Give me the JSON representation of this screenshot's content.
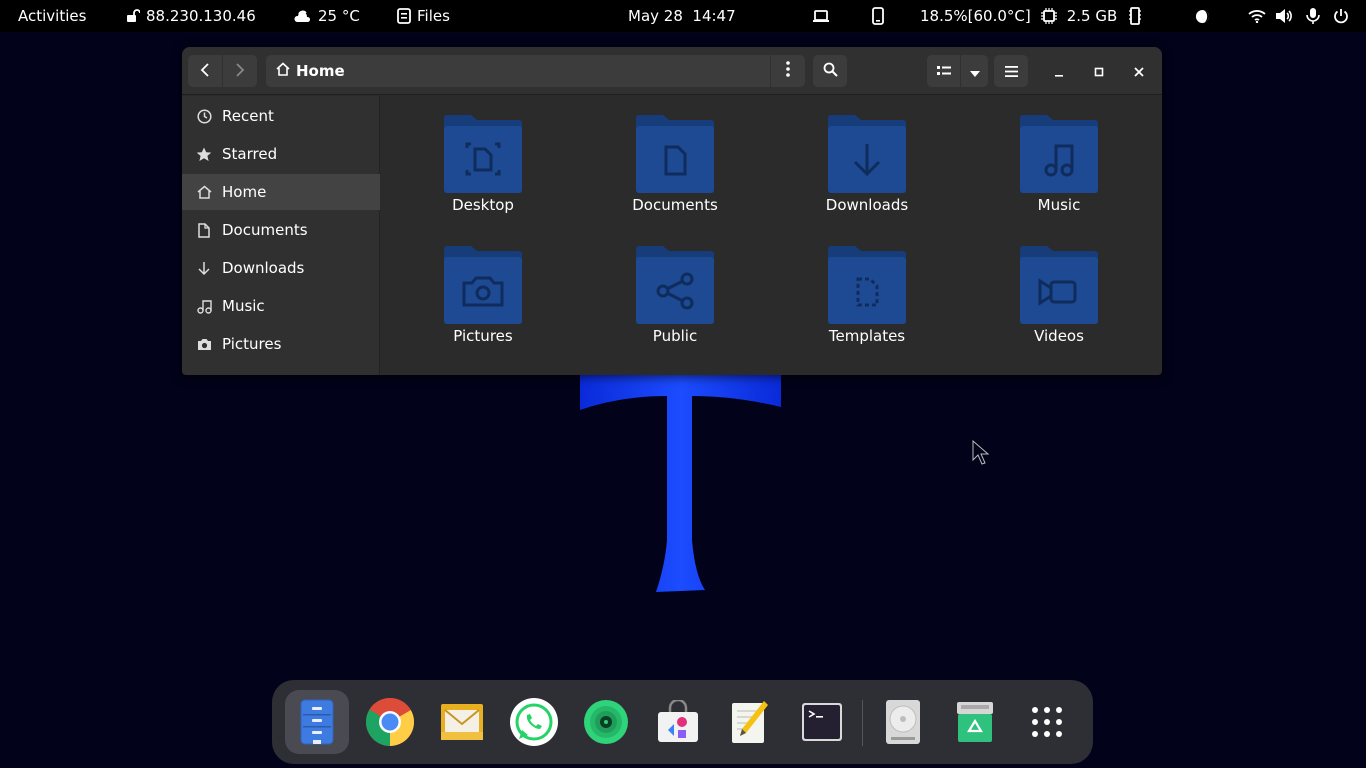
{
  "topbar": {
    "activities": "Activities",
    "ip": "88.230.130.46",
    "weather": "25 °C",
    "app_name": "Files",
    "clock": "May 28  14:47",
    "cpu": "18.5%[60.0°C]",
    "memory": "2.5 GB"
  },
  "window": {
    "path_label": "Home",
    "colors": {
      "folder": "#1d4a93",
      "folder_dark": "#173c7a",
      "glyph": "#0f2c5c"
    }
  },
  "sidebar": {
    "items": [
      {
        "label": "Recent",
        "icon": "clock-icon"
      },
      {
        "label": "Starred",
        "icon": "star-icon"
      },
      {
        "label": "Home",
        "icon": "home-icon"
      },
      {
        "label": "Documents",
        "icon": "document-icon"
      },
      {
        "label": "Downloads",
        "icon": "download-icon"
      },
      {
        "label": "Music",
        "icon": "music-icon"
      },
      {
        "label": "Pictures",
        "icon": "camera-icon"
      }
    ],
    "active": "Home"
  },
  "folders": [
    {
      "label": "Desktop",
      "icon": "desktop-folder-icon"
    },
    {
      "label": "Documents",
      "icon": "documents-folder-icon"
    },
    {
      "label": "Downloads",
      "icon": "downloads-folder-icon"
    },
    {
      "label": "Music",
      "icon": "music-folder-icon"
    },
    {
      "label": "Pictures",
      "icon": "pictures-folder-icon"
    },
    {
      "label": "Public",
      "icon": "public-folder-icon"
    },
    {
      "label": "Templates",
      "icon": "templates-folder-icon"
    },
    {
      "label": "Videos",
      "icon": "videos-folder-icon"
    }
  ],
  "dock": {
    "apps": [
      {
        "name": "Files",
        "icon": "files-app-icon",
        "running": true
      },
      {
        "name": "Google Chrome",
        "icon": "chrome-app-icon"
      },
      {
        "name": "Mail",
        "icon": "mail-app-icon"
      },
      {
        "name": "WhatsApp",
        "icon": "whatsapp-app-icon"
      },
      {
        "name": "Music Player",
        "icon": "music-player-app-icon"
      },
      {
        "name": "Software",
        "icon": "software-app-icon"
      },
      {
        "name": "Text Editor",
        "icon": "text-editor-app-icon"
      },
      {
        "name": "Terminal",
        "icon": "terminal-app-icon"
      },
      {
        "name": "Disk",
        "icon": "disk-icon"
      },
      {
        "name": "Trash",
        "icon": "trash-icon"
      },
      {
        "name": "Show Applications",
        "icon": "app-grid-icon"
      }
    ]
  }
}
